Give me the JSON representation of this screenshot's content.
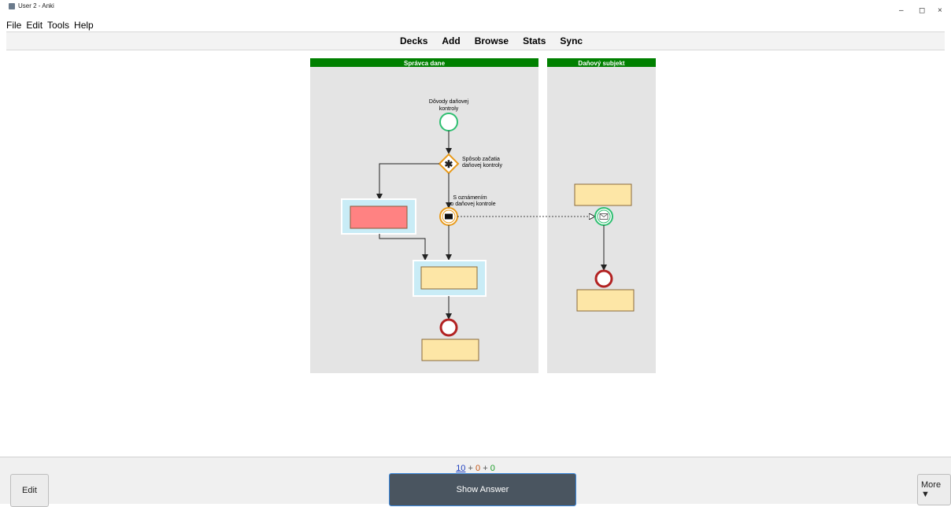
{
  "window": {
    "title": "User 2 - Anki",
    "controls": {
      "minimize": "–",
      "maximize": "◻",
      "close": "×"
    }
  },
  "menu": [
    "File",
    "Edit",
    "Tools",
    "Help"
  ],
  "toolbar": [
    "Decks",
    "Add",
    "Browse",
    "Stats",
    "Sync"
  ],
  "diagram": {
    "lane_left_title": "Správca dane",
    "lane_right_title": "Daňový subjekt",
    "start_label_line1": "Dôvody daňovej",
    "start_label_line2": "kontroly",
    "gateway_label_line1": "Spôsob začatia",
    "gateway_label_line2": "daňovej kontroly",
    "message_label_line1": "S oznámením",
    "message_label_line2": "o daňovej kontrole"
  },
  "colors": {
    "lane_header": "#008000",
    "lane_bg": "#e4e4e4",
    "task_fill": "#fde6a6",
    "task_red": "#ff8282",
    "highlight": "#c9ecf6",
    "start_event": "#2fbf71",
    "end_event": "#b22222",
    "gateway": "#e89a1b"
  },
  "counts": {
    "new": "10",
    "learning": "0",
    "review": "0",
    "sep": "+"
  },
  "buttons": {
    "edit": "Edit",
    "show_answer": "Show Answer",
    "more": "More ▼"
  }
}
